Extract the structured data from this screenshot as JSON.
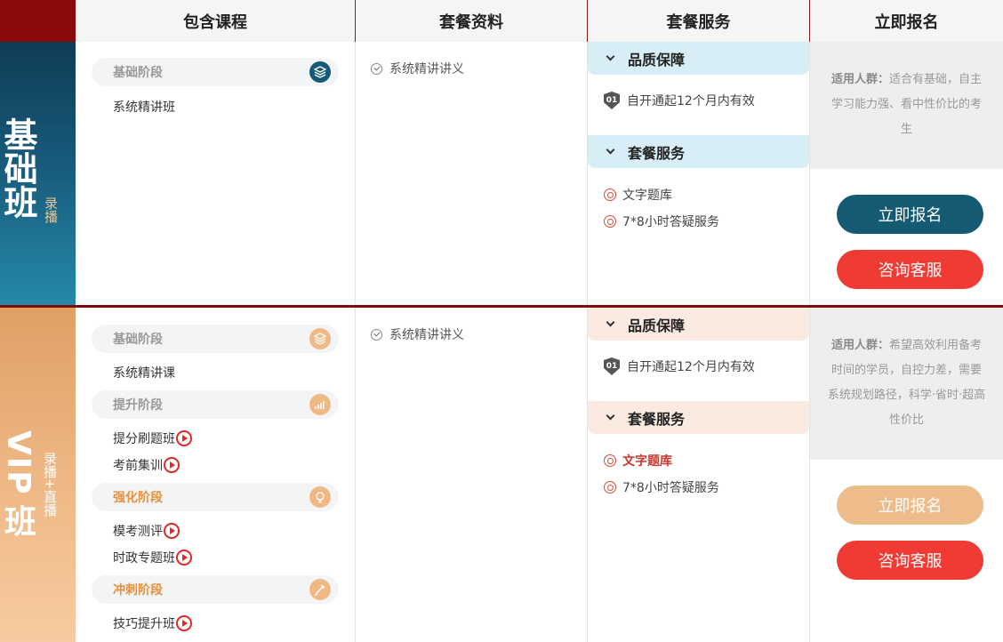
{
  "header": {
    "col1": "包含课程",
    "col2": "套餐资料",
    "col3": "套餐服务",
    "col4": "立即报名"
  },
  "basic": {
    "side_title": "基础班",
    "side_sub": "录播",
    "stages": [
      {
        "label": "基础阶段",
        "icon": "layers-icon"
      }
    ],
    "courses": [
      "系统精讲班"
    ],
    "materials": [
      "系统精讲讲义"
    ],
    "quality_title": "品质保障",
    "quality_item": "自开通起12个月内有效",
    "quality_badge": "01",
    "service_title": "套餐服务",
    "services": [
      "文字题库",
      "7*8小时答疑服务"
    ],
    "audience_label": "适用人群：",
    "audience_text": "适合有基础，自主学习能力强、看中性价比的考生",
    "signup_button": "立即报名",
    "consult_button": "咨询客服"
  },
  "vip": {
    "side_title_1": "VIP",
    "side_title_2": "班",
    "side_sub": "录播+直播",
    "stages": [
      {
        "label": "基础阶段",
        "icon": "layers-icon"
      },
      {
        "label": "提升阶段",
        "icon": "chart-icon"
      },
      {
        "label": "强化阶段",
        "icon": "bulb-icon"
      },
      {
        "label": "冲刺阶段",
        "icon": "rocket-icon"
      }
    ],
    "courses": [
      "系统精讲课",
      "提分刷题班",
      "考前集训",
      "模考测评",
      "时政专题班",
      "技巧提升班"
    ],
    "materials": [
      "系统精讲讲义"
    ],
    "quality_title": "品质保障",
    "quality_item": "自开通起12个月内有效",
    "quality_badge": "01",
    "service_title": "套餐服务",
    "services": [
      "文字题库",
      "7*8小时答疑服务"
    ],
    "audience_label": "适用人群：",
    "audience_text": "希望高效利用备考时间的学员，自控力差，需要系统规划路径，科学·省时·超高性价比",
    "signup_button": "立即报名",
    "consult_button": "咨询客服"
  },
  "colors": {
    "header_corner": "#8a0a0a",
    "teal": "#155a73",
    "red": "#ef3b34",
    "peach": "#eebc8b",
    "stage_orange": "#e8903c"
  }
}
